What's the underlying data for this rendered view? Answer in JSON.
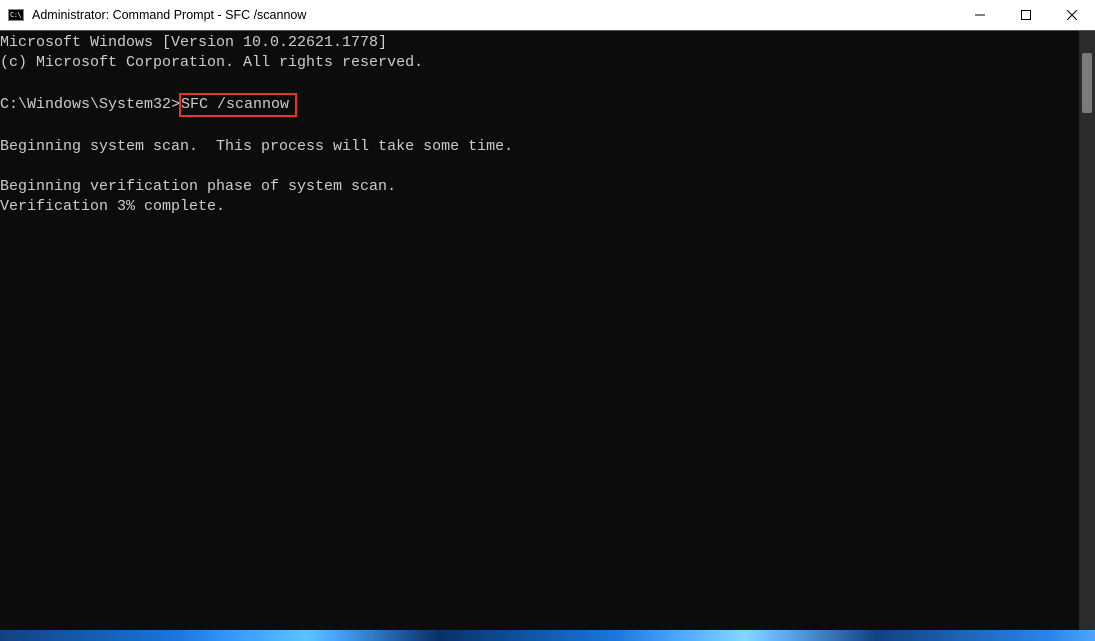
{
  "window": {
    "title": "Administrator: Command Prompt - SFC  /scannow",
    "icon_label": "C:\\"
  },
  "terminal": {
    "line1": "Microsoft Windows [Version 10.0.22621.1778]",
    "line2": "(c) Microsoft Corporation. All rights reserved.",
    "blank1": "",
    "prompt_prefix": "C:\\Windows\\System32>",
    "prompt_cmd": "SFC /scannow",
    "blank2": "",
    "line5": "Beginning system scan.  This process will take some time.",
    "blank3": "",
    "line6": "Beginning verification phase of system scan.",
    "line7": "Verification 3% complete."
  }
}
